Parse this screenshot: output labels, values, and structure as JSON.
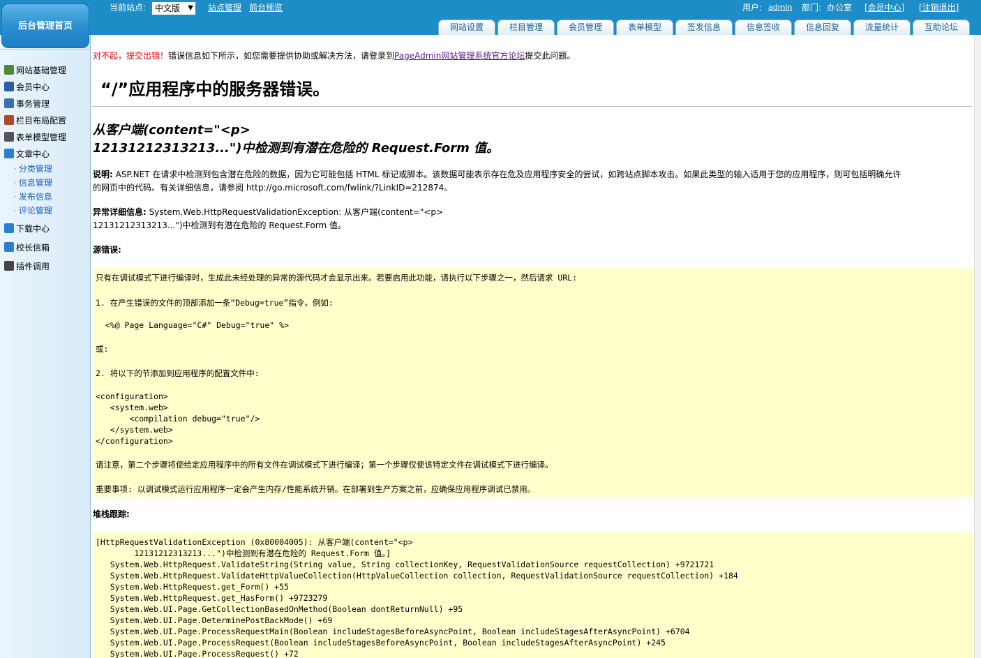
{
  "header": {
    "home_label": "后台管理首页",
    "current_site_label": "当前站点:",
    "site_select_value": "中文版",
    "site_manage_link": "站点管理",
    "front_preview_link": "前台预览",
    "user_label": "用户:",
    "user_value": "admin",
    "dept_label": "部门:",
    "dept_value": "办公室",
    "member_center_link": "[会员中心]",
    "logout_link": "[注销退出]"
  },
  "tabs": [
    "网站设置",
    "栏目管理",
    "会员管理",
    "表单模型",
    "签发信息",
    "信息签收",
    "信息回复",
    "流量统计",
    "互助论坛"
  ],
  "sidebar": {
    "items": [
      {
        "label": "网站基础管理",
        "icon": "site-base-icon",
        "color": "#4a8a3a"
      },
      {
        "label": "会员中心",
        "icon": "members-icon",
        "color": "#2a5fa8"
      },
      {
        "label": "事务管理",
        "icon": "affairs-icon",
        "color": "#3a6fb0"
      },
      {
        "label": "栏目布局配置",
        "icon": "tools-icon",
        "color": "#b04a2a"
      },
      {
        "label": "表单模型管理",
        "icon": "form-icon",
        "color": "#555555"
      },
      {
        "label": "文章中心",
        "icon": "ie-icon",
        "color": "#2a7fd0"
      }
    ],
    "sub_items": [
      "分类管理",
      "信息管理",
      "发布信息",
      "评论管理"
    ],
    "items_after": [
      {
        "label": "下载中心",
        "icon": "ie-icon",
        "color": "#2a7fd0"
      },
      {
        "label": "校长信箱",
        "icon": "ie-icon",
        "color": "#2a7fd0"
      },
      {
        "label": "插件调用",
        "icon": "plugin-icon",
        "color": "#444444"
      }
    ]
  },
  "notice": {
    "red": "对不起，提交出错！",
    "text": "错误信息如下所示，如您需要提供协助或解决方法，请登录到",
    "link": "PageAdmin网站管理系统官方论坛",
    "tail": "提交此问题。"
  },
  "error": {
    "title": "“/”应用程序中的服务器错误。",
    "subtitle_1": "从客户端(content=\"<p>",
    "subtitle_2": "12131212313213...\")中检测到有潜在危险的 Request.Form 值。",
    "desc_label": "说明:",
    "desc_text_1": "ASP.NET 在请求中检测到包含潜在危险的数据，因为它可能包括 HTML 标记或脚本。该数据可能表示存在危及应用程序安全的尝试，如跨站点脚本攻击。如果此类型的输入适用于您的应用程序，则可包括明确允许",
    "desc_text_2": "的网页中的代码。有关详细信息，请参阅 http://go.microsoft.com/fwlink/?LinkID=212874。",
    "detail_label": "异常详细信息:",
    "detail_text_1": "System.Web.HttpRequestValidationException: 从客户端(content=\"<p>",
    "detail_text_2": "12131212313213...\")中检测到有潜在危险的 Request.Form 值。",
    "source_label": "源错误:",
    "stack_label": "堆栈跟踪:"
  },
  "source_box": [
    "只有在调试模式下进行编译时，生成此未经处理的异常的源代码才会显示出来。若要启用此功能，请执行以下步骤之一，然后请求 URL:",
    "1. 在产生错误的文件的顶部添加一条“Debug=true”指令。例如:",
    "  <%@ Page Language=\"C#\" Debug=\"true\" %>",
    "或:",
    "2. 将以下的节添加到应用程序的配置文件中:",
    "<configuration>",
    "   <system.web>",
    "       <compilation debug=\"true\"/>",
    "   </system.web>",
    "</configuration>",
    "请注意，第二个步骤将使给定应用程序中的所有文件在调试模式下进行编译；第一个步骤仅使该特定文件在调试模式下进行编译。",
    "重要事项: 以调试模式运行应用程序一定会产生内存/性能系统开销。在部署到生产方案之前，应确保应用程序调试已禁用。"
  ],
  "stack_box": [
    "[HttpRequestValidationException (0x80004005): 从客户端(content=\"<p>",
    "        12131212313213...\")中检测到有潜在危险的 Request.Form 值。]",
    "   System.Web.HttpRequest.ValidateString(String value, String collectionKey, RequestValidationSource requestCollection) +9721721",
    "   System.Web.HttpRequest.ValidateHttpValueCollection(HttpValueCollection collection, RequestValidationSource requestCollection) +184",
    "   System.Web.HttpRequest.get_Form() +55",
    "   System.Web.HttpRequest.get_HasForm() +9723279",
    "   System.Web.UI.Page.GetCollectionBasedOnMethod(Boolean dontReturnNull) +95",
    "   System.Web.UI.Page.DeterminePostBackMode() +69",
    "   System.Web.UI.Page.ProcessRequestMain(Boolean includeStagesBeforeAsyncPoint, Boolean includeStagesAfterAsyncPoint) +6704",
    "   System.Web.UI.Page.ProcessRequest(Boolean includeStagesBeforeAsyncPoint, Boolean includeStagesAfterAsyncPoint) +245",
    "   System.Web.UI.Page.ProcessRequest() +72"
  ]
}
